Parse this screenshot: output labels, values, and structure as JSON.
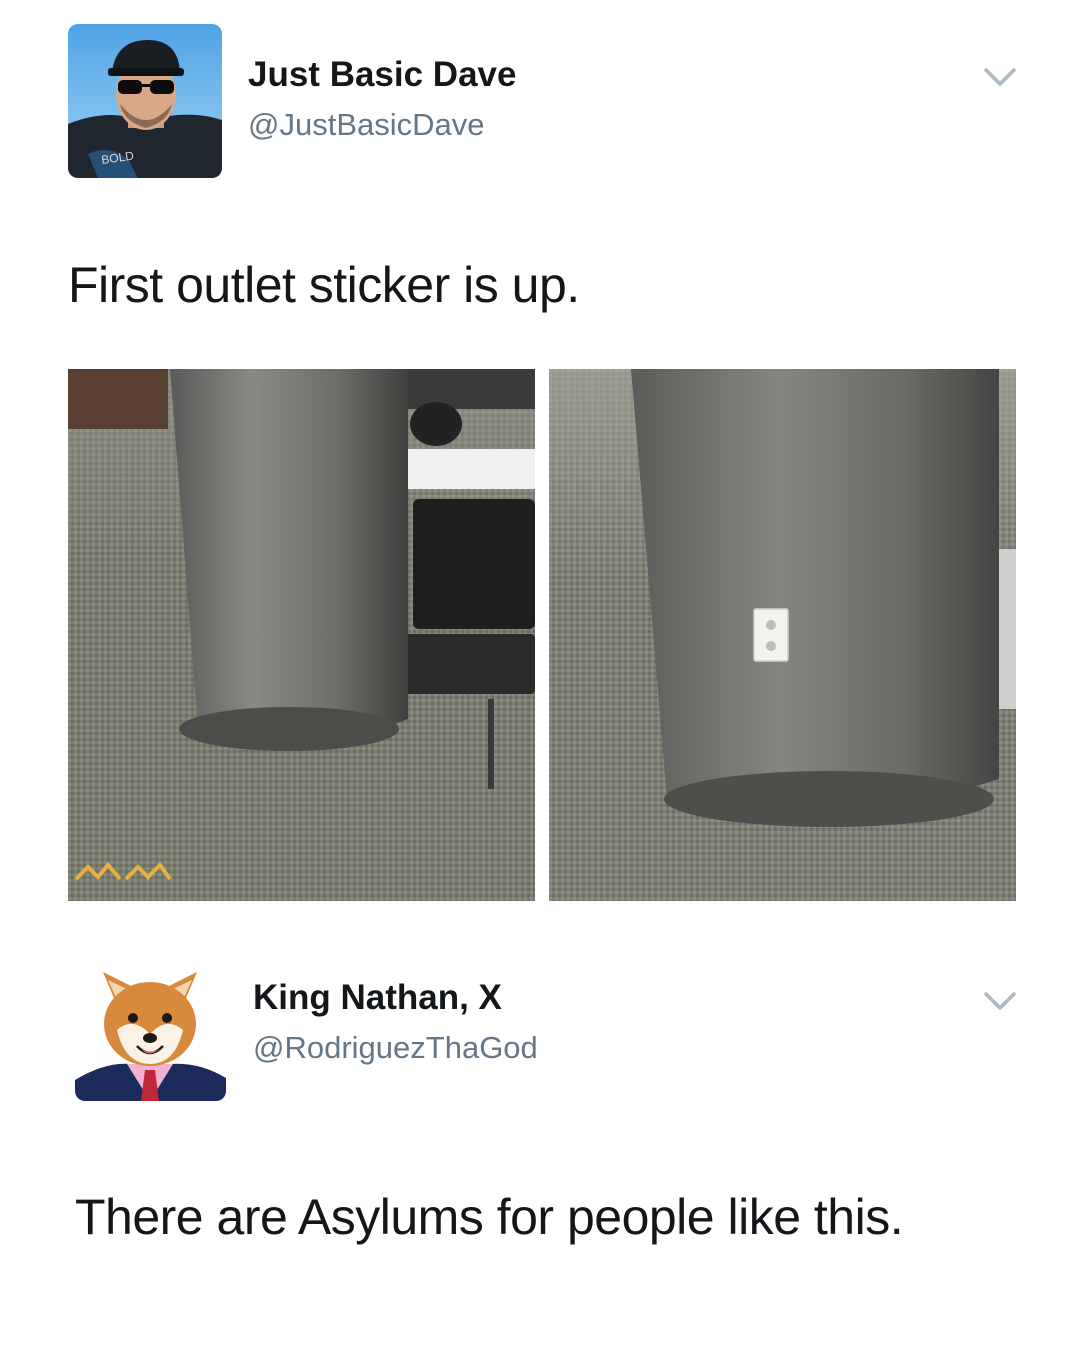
{
  "tweet1": {
    "display_name": "Just Basic Dave",
    "handle": "@JustBasicDave",
    "text": "First outlet sticker is up.",
    "avatar_icon": "man-with-sunglasses-avatar",
    "menu_icon": "chevron-down-icon",
    "photos": [
      {
        "description_icon": "pillar-without-outlet-photo"
      },
      {
        "description_icon": "pillar-with-outlet-sticker-photo"
      }
    ]
  },
  "tweet2": {
    "display_name": "King Nathan, X",
    "handle": "@RodriguezThaGod",
    "text": "There are Asylums for people like this.",
    "avatar_icon": "shiba-in-suit-avatar",
    "menu_icon": "chevron-down-icon"
  },
  "colors": {
    "text_primary": "#14171a",
    "text_secondary": "#657786",
    "chevron": "#aab8c2",
    "background": "#ffffff"
  }
}
